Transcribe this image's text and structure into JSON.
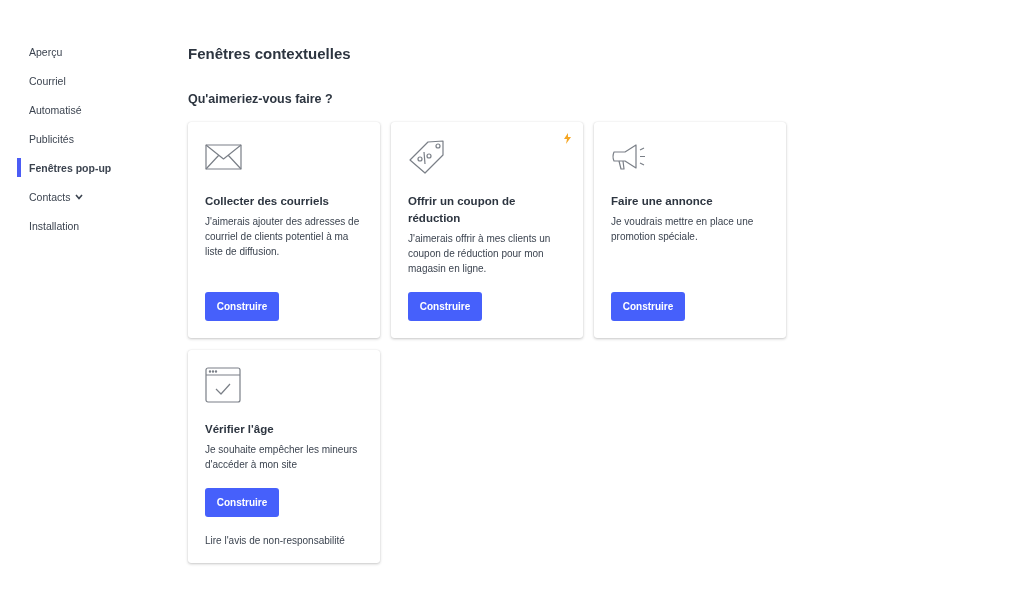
{
  "sidebar": {
    "items": [
      {
        "label": "Aperçu",
        "selected": false
      },
      {
        "label": "Courriel",
        "selected": false
      },
      {
        "label": "Automatisé",
        "selected": false
      },
      {
        "label": "Publicités",
        "selected": false
      },
      {
        "label": "Fenêtres pop-up",
        "selected": true
      },
      {
        "label": "Contacts",
        "selected": false,
        "has_submenu": true
      },
      {
        "label": "Installation",
        "selected": false
      }
    ]
  },
  "page": {
    "title": "Fenêtres contextuelles",
    "subtitle": "Qu'aimeriez-vous faire ?"
  },
  "cards": [
    {
      "kind": "envelope",
      "title": "Collecter des courriels",
      "description": "J'aimerais ajouter des adresses de courriel de clients potentiel à ma liste de diffusion.",
      "button": "Construire",
      "featured": false
    },
    {
      "kind": "tag",
      "title": "Offrir un coupon de réduction",
      "description": "J'aimerais offrir à mes clients un coupon de réduction pour mon magasin en ligne.",
      "button": "Construire",
      "featured": true
    },
    {
      "kind": "megaphone",
      "title": "Faire une annonce",
      "description": "Je voudrais mettre en place une promotion spéciale.",
      "button": "Construire",
      "featured": false
    },
    {
      "kind": "browser",
      "title": "Vérifier l'âge",
      "description": "Je souhaite empêcher les mineurs d'accéder à mon site",
      "button": "Construire",
      "featured": false,
      "link": "Lire l'avis de non-responsabilité"
    }
  ]
}
